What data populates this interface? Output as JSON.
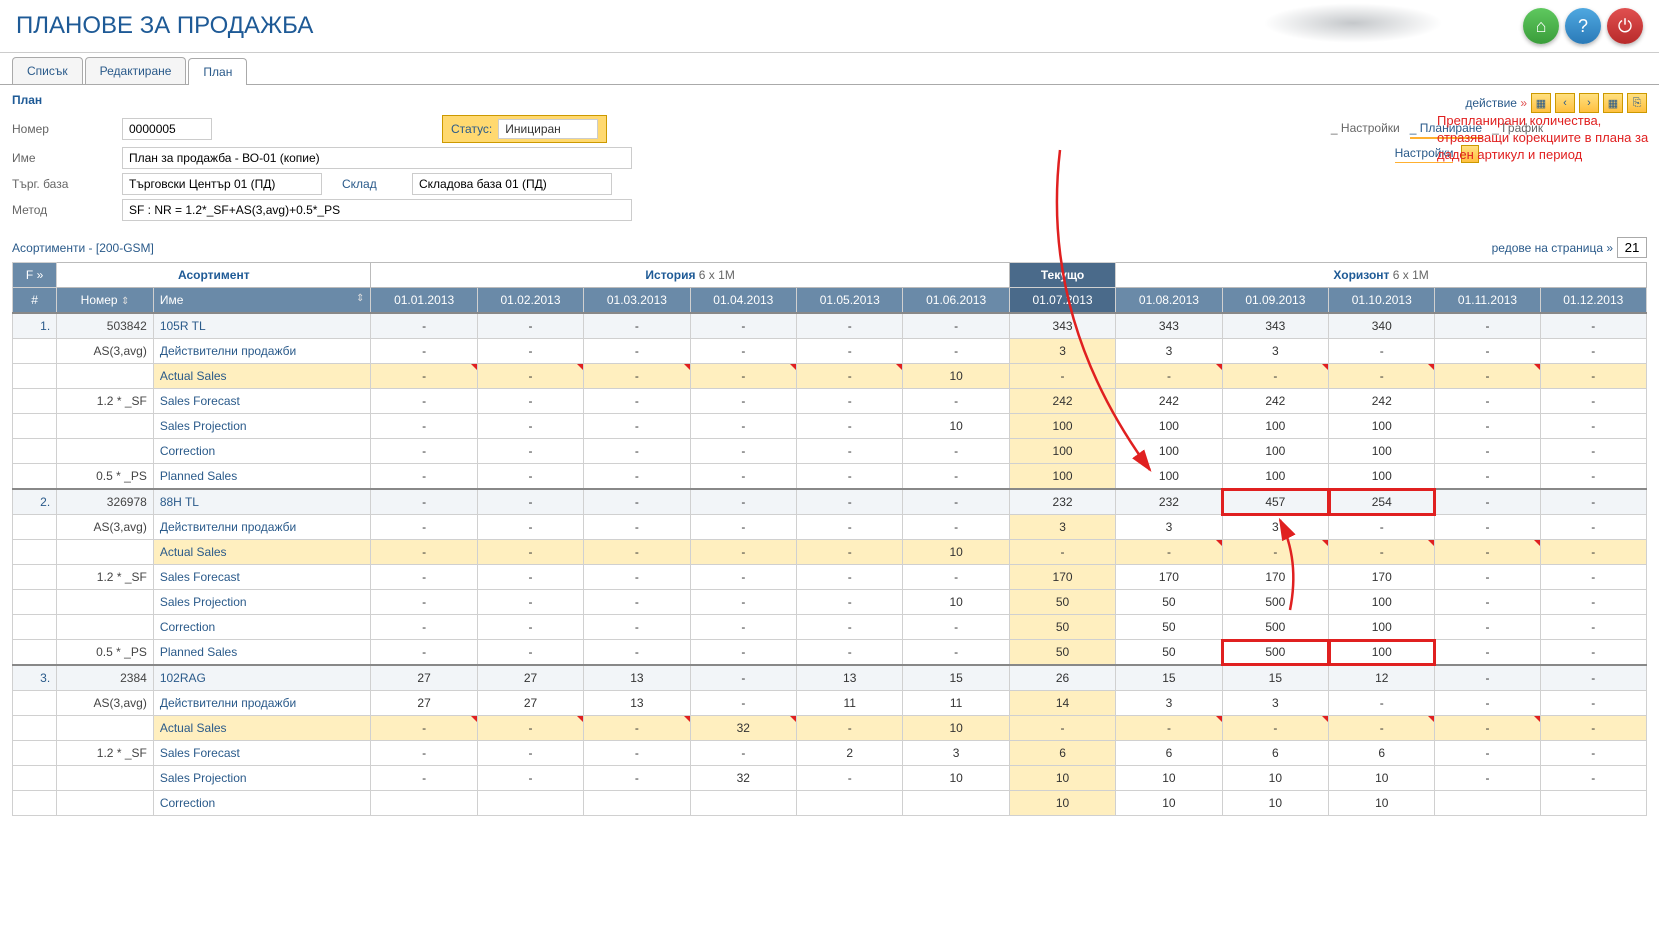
{
  "page_title": "ПЛАНОВЕ ЗА ПРОДАЖБА",
  "tabs": [
    "Списък",
    "Редактиране",
    "План"
  ],
  "active_tab": 2,
  "plan_label": "План",
  "form": {
    "number_label": "Номер",
    "number": "0000005",
    "status_label": "Статус:",
    "status": "Инициран",
    "name_label": "Име",
    "name": "План за продажба - ВО-01 (копие)",
    "base_label": "Търг. база",
    "base": "Търговски Център 01 (ПД)",
    "warehouse_label": "Склад",
    "warehouse": "Складова база 01 (ПД)",
    "method_label": "Метод",
    "method": "SF : NR = 1.2*_SF+AS(3,avg)+0.5*_PS"
  },
  "action": {
    "label": "действие",
    "subtabs": [
      "_ Настройки",
      "_ Планиране",
      "_ График"
    ],
    "active_subtab": 1,
    "settings": "Настройки"
  },
  "annotation": "Препланирани количества, отразяващи корекциите в плана за даден артикул и период",
  "assortment": {
    "label": "Асортименти -",
    "val": "[200-GSM]",
    "rows_label": "редове на страница »",
    "rows": "21"
  },
  "headers": {
    "f": "F »",
    "assortment": "Асортимент",
    "history": "История",
    "history_suffix": "6 x 1M",
    "current": "Текущо",
    "horizon": "Хоризонт",
    "horizon_suffix": "6 x 1M",
    "num": "#",
    "number": "Номер",
    "name": "Име",
    "dates": [
      "01.01.2013",
      "01.02.2013",
      "01.03.2013",
      "01.04.2013",
      "01.05.2013",
      "01.06.2013",
      "01.07.2013",
      "01.08.2013",
      "01.09.2013",
      "01.10.2013",
      "01.11.2013",
      "01.12.2013"
    ]
  },
  "rows": [
    {
      "idx": "1.",
      "code": "503842",
      "name": "105R TL",
      "main": true,
      "class": "alt",
      "v": [
        "-",
        "-",
        "-",
        "-",
        "-",
        "-",
        "343",
        "343",
        "343",
        "340",
        "-",
        "-"
      ]
    },
    {
      "code": "AS(3,avg)",
      "name": "Действителни продажби",
      "v": [
        "-",
        "-",
        "-",
        "-",
        "-",
        "-",
        "3",
        "3",
        "3",
        "-",
        "-",
        "-"
      ]
    },
    {
      "name": "Actual Sales",
      "yellow": true,
      "flag_cols": [
        0,
        1,
        2,
        3,
        4,
        7,
        8,
        9,
        10
      ],
      "v": [
        "-",
        "-",
        "-",
        "-",
        "-",
        "10",
        "-",
        "-",
        "-",
        "-",
        "-",
        "-"
      ]
    },
    {
      "code": "1.2 * _SF",
      "name": "Sales Forecast",
      "v": [
        "-",
        "-",
        "-",
        "-",
        "-",
        "-",
        "242",
        "242",
        "242",
        "242",
        "-",
        "-"
      ]
    },
    {
      "name": "Sales Projection",
      "v": [
        "-",
        "-",
        "-",
        "-",
        "-",
        "10",
        "100",
        "100",
        "100",
        "100",
        "-",
        "-"
      ]
    },
    {
      "name": "Correction",
      "v": [
        "-",
        "-",
        "-",
        "-",
        "-",
        "-",
        "100",
        "100",
        "100",
        "100",
        "-",
        "-"
      ]
    },
    {
      "code": "0.5 * _PS",
      "name": "Planned Sales",
      "v": [
        "-",
        "-",
        "-",
        "-",
        "-",
        "-",
        "100",
        "100",
        "100",
        "100",
        "-",
        "-"
      ]
    },
    {
      "idx": "2.",
      "code": "326978",
      "name": "88H TL",
      "main": true,
      "class": "alt",
      "red_cols": [
        8,
        9
      ],
      "v": [
        "-",
        "-",
        "-",
        "-",
        "-",
        "-",
        "232",
        "232",
        "457",
        "254",
        "-",
        "-"
      ]
    },
    {
      "code": "AS(3,avg)",
      "name": "Действителни продажби",
      "v": [
        "-",
        "-",
        "-",
        "-",
        "-",
        "-",
        "3",
        "3",
        "3",
        "-",
        "-",
        "-"
      ]
    },
    {
      "name": "Actual Sales",
      "yellow": true,
      "flag_cols": [
        7,
        8,
        9,
        10
      ],
      "v": [
        "-",
        "-",
        "-",
        "-",
        "-",
        "10",
        "-",
        "-",
        "-",
        "-",
        "-",
        "-"
      ]
    },
    {
      "code": "1.2 * _SF",
      "name": "Sales Forecast",
      "v": [
        "-",
        "-",
        "-",
        "-",
        "-",
        "-",
        "170",
        "170",
        "170",
        "170",
        "-",
        "-"
      ]
    },
    {
      "name": "Sales Projection",
      "v": [
        "-",
        "-",
        "-",
        "-",
        "-",
        "10",
        "50",
        "50",
        "500",
        "100",
        "-",
        "-"
      ]
    },
    {
      "name": "Correction",
      "v": [
        "-",
        "-",
        "-",
        "-",
        "-",
        "-",
        "50",
        "50",
        "500",
        "100",
        "-",
        "-"
      ]
    },
    {
      "code": "0.5 * _PS",
      "name": "Planned Sales",
      "red_cols": [
        8,
        9
      ],
      "v": [
        "-",
        "-",
        "-",
        "-",
        "-",
        "-",
        "50",
        "50",
        "500",
        "100",
        "-",
        "-"
      ]
    },
    {
      "idx": "3.",
      "code": "2384",
      "name": "102RAG",
      "main": true,
      "class": "alt",
      "v": [
        "27",
        "27",
        "13",
        "-",
        "13",
        "15",
        "26",
        "15",
        "15",
        "12",
        "-",
        "-"
      ]
    },
    {
      "code": "AS(3,avg)",
      "name": "Действителни продажби",
      "v": [
        "27",
        "27",
        "13",
        "-",
        "11",
        "11",
        "14",
        "3",
        "3",
        "-",
        "-",
        "-"
      ]
    },
    {
      "name": "Actual Sales",
      "yellow": true,
      "flag_cols": [
        0,
        1,
        2,
        3,
        7,
        8,
        9,
        10
      ],
      "v": [
        "-",
        "-",
        "-",
        "32",
        "-",
        "10",
        "-",
        "-",
        "-",
        "-",
        "-",
        "-"
      ]
    },
    {
      "code": "1.2 * _SF",
      "name": "Sales Forecast",
      "v": [
        "-",
        "-",
        "-",
        "-",
        "2",
        "3",
        "6",
        "6",
        "6",
        "6",
        "-",
        "-"
      ]
    },
    {
      "name": "Sales Projection",
      "v": [
        "-",
        "-",
        "-",
        "32",
        "-",
        "10",
        "10",
        "10",
        "10",
        "10",
        "-",
        "-"
      ]
    },
    {
      "name": "Correction",
      "v": [
        "",
        "",
        "",
        "",
        "",
        "",
        "10",
        "10",
        "10",
        "10",
        "",
        ""
      ]
    }
  ]
}
